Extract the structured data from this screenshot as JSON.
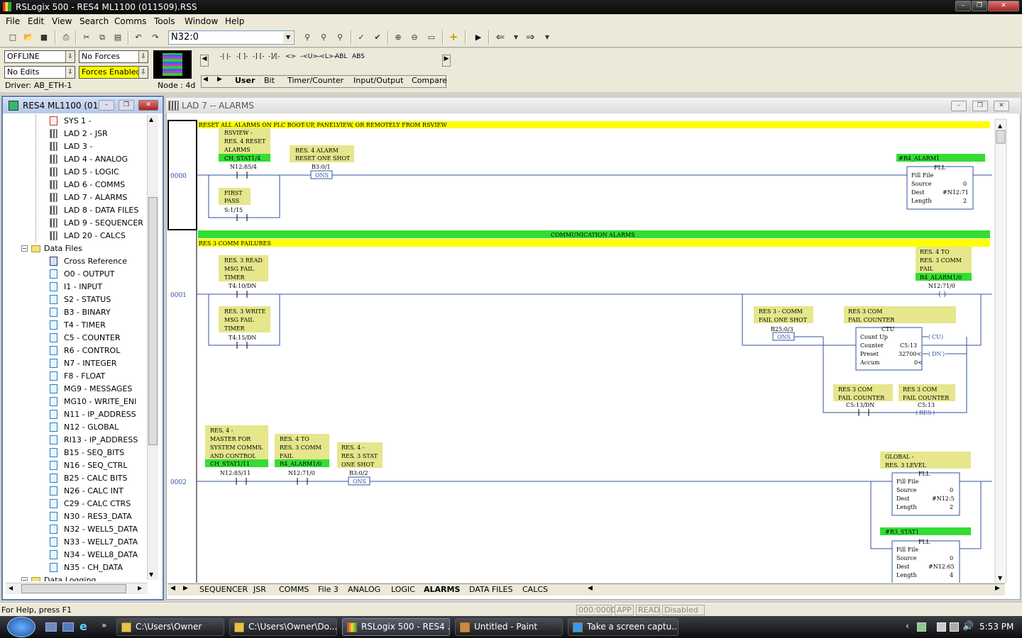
{
  "window": {
    "title": "RSLogix 500 - RES4 ML1100 (011509).RSS"
  },
  "menu": [
    "File",
    "Edit",
    "View",
    "Search",
    "Comms",
    "Tools",
    "Window",
    "Help"
  ],
  "address_box": "N32:0",
  "mode": {
    "online": "OFFLINE",
    "edits": "No Edits",
    "forces": "No Forces",
    "forces_enabled": "Forces Enabled",
    "driver": "Driver: AB_ETH-1",
    "node": "Node :  4d"
  },
  "instruction_palette": [
    "-| |-",
    "-[ ]-",
    "-] [-",
    "-]/[-",
    "<>",
    "-<U>-",
    "-<L>-",
    "ABL",
    "ABS"
  ],
  "instruction_tabs": [
    "User",
    "Bit",
    "Timer/Counter",
    "Input/Output",
    "Compare"
  ],
  "project_tree": {
    "title": "RES4 ML1100 (01...",
    "items": [
      {
        "label": "SYS 1 -",
        "type": "sys"
      },
      {
        "label": "LAD 2 - JSR",
        "type": "lad"
      },
      {
        "label": "LAD 3 -",
        "type": "lad"
      },
      {
        "label": "LAD 4 - ANALOG",
        "type": "lad"
      },
      {
        "label": "LAD 5 - LOGIC",
        "type": "lad"
      },
      {
        "label": "LAD 6 - COMMS",
        "type": "lad"
      },
      {
        "label": "LAD 7 - ALARMS",
        "type": "lad"
      },
      {
        "label": "LAD 8 - DATA FILES",
        "type": "lad"
      },
      {
        "label": "LAD 9 - SEQUENCER",
        "type": "lad"
      },
      {
        "label": "LAD 20 - CALCS",
        "type": "lad"
      },
      {
        "label": "Data Files",
        "type": "folder"
      },
      {
        "label": "Cross Reference",
        "type": "xref"
      },
      {
        "label": "O0 - OUTPUT",
        "type": "data"
      },
      {
        "label": "I1 - INPUT",
        "type": "data"
      },
      {
        "label": "S2 - STATUS",
        "type": "data"
      },
      {
        "label": "B3 - BINARY",
        "type": "data"
      },
      {
        "label": "T4 - TIMER",
        "type": "data"
      },
      {
        "label": "C5 - COUNTER",
        "type": "data"
      },
      {
        "label": "R6 - CONTROL",
        "type": "data"
      },
      {
        "label": "N7 - INTEGER",
        "type": "data"
      },
      {
        "label": "F8 - FLOAT",
        "type": "data"
      },
      {
        "label": "MG9 - MESSAGES",
        "type": "data"
      },
      {
        "label": "MG10 - WRITE_ENI",
        "type": "data"
      },
      {
        "label": "N11 - IP_ADDRESS",
        "type": "data"
      },
      {
        "label": "N12 - GLOBAL",
        "type": "data"
      },
      {
        "label": "RI13 - IP_ADDRESS",
        "type": "data"
      },
      {
        "label": "B15 - SEQ_BITS",
        "type": "data"
      },
      {
        "label": "N16 - SEQ_CTRL",
        "type": "data"
      },
      {
        "label": "B25 - CALC BITS",
        "type": "data"
      },
      {
        "label": "N26 - CALC INT",
        "type": "data"
      },
      {
        "label": "C29 - CALC CTRS",
        "type": "data"
      },
      {
        "label": "N30 - RES3_DATA",
        "type": "data"
      },
      {
        "label": "N32 - WELL5_DATA",
        "type": "data"
      },
      {
        "label": "N33 - WELL7_DATA",
        "type": "data"
      },
      {
        "label": "N34 - WELL8_DATA",
        "type": "data"
      },
      {
        "label": "N35 - CH_DATA",
        "type": "data"
      },
      {
        "label": "Data Logging",
        "type": "folder"
      }
    ]
  },
  "ladder": {
    "title": "LAD 7 -- ALARMS",
    "rung0": {
      "num": "0000",
      "comment": "RESET ALL ALARMS ON PLC BOOT-UP, PANELVIEW, OR REMOTELY FROM RSVIEW",
      "c1": [
        "RSVIEW -",
        "RES. 4 RESET",
        "ALARMS"
      ],
      "c1_sym": "CH_STAT1/4",
      "c1_addr": "N12:85/4",
      "ons": [
        "RES. 4 ALARM",
        "RESET ONE SHOT"
      ],
      "ons_addr": "B3:0/1",
      "ons_txt": "ONS",
      "fp": [
        "FIRST",
        "PASS"
      ],
      "fp_addr": "S:1/15",
      "fll_sym": "#R4_ALARM1",
      "fll_title": "FLL",
      "fll_name": "Fill File",
      "fll_src_l": "Source",
      "fll_src": "0",
      "fll_dest_l": "Dest",
      "fll_dest": "#N12:71",
      "fll_len_l": "Length",
      "fll_len": "2"
    },
    "rung1": {
      "num": "0001",
      "comment": "COMMUNICATION ALARMS",
      "comment2": "RES 3 COMM FAILURES",
      "c1": [
        "RES. 3 READ",
        "MSG FAIL",
        "TIMER"
      ],
      "c1_addr": "T4:10/DN",
      "c2": [
        "RES. 3 WRITE",
        "MSG FAIL",
        "TIMER"
      ],
      "c2_addr": "T4:15/DN",
      "ons": [
        "RES 3 - COMM",
        "FAIL ONE SHOT"
      ],
      "ons_addr": "B25:0/3",
      "ons_txt": "ONS",
      "ctu_desc": [
        "RES 3 COM",
        "FAIL COUNTER"
      ],
      "ctu_title": "CTU",
      "ctu_name": "Count Up",
      "ctu_c_l": "Counter",
      "ctu_c": "C5:13",
      "ctu_p_l": "Preset",
      "ctu_p": "32700<",
      "ctu_a_l": "Accum",
      "ctu_a": "0<",
      "cu": "CU",
      "dn": "DN",
      "c3": [
        "RES 3 COM",
        "FAIL COUNTER"
      ],
      "c3_addr": "C5:13/DN",
      "res": [
        "RES 3 COM",
        "FAIL COUNTER"
      ],
      "res_addr": "C5:13",
      "res_txt": "RES",
      "out": [
        "RES. 4 TO",
        "RES. 3 COMM",
        "FAIL"
      ],
      "out_sym": "R4_ALARM1/0",
      "out_addr": "N12:71/0"
    },
    "rung2": {
      "num": "0002",
      "c1": [
        "RES. 4 -",
        "MASTER FOR",
        "SYSTEM COMMS.",
        "AND CONTROL"
      ],
      "c1_sym": "CH_STAT1/11",
      "c1_addr": "N12:85/11",
      "c2": [
        "RES. 4 TO",
        "RES. 3 COMM",
        "FAIL"
      ],
      "c2_sym": "R4_ALARM1/0",
      "c2_addr": "N12:71/0",
      "ons": [
        "RES. 4 -",
        "RES. 3 STAT",
        "ONE SHOT"
      ],
      "ons_addr": "B3:0/2",
      "ons_txt": "ONS",
      "fll1_desc": [
        "GLOBAL -",
        "RES. 3 LEVEL"
      ],
      "fll1_title": "FLL",
      "fll1_name": "Fill File",
      "fll1_src_l": "Source",
      "fll1_src": "0",
      "fll1_dest_l": "Dest",
      "fll1_dest": "#N12:5",
      "fll1_len_l": "Length",
      "fll1_len": "2",
      "fll2_sym": "#R3_STAT1",
      "fll2_title": "FLL",
      "fll2_name": "Fill File",
      "fll2_src_l": "Source",
      "fll2_src": "0",
      "fll2_dest_l": "Dest",
      "fll2_dest": "#N12:65",
      "fll2_len_l": "Length",
      "fll2_len": "4"
    }
  },
  "bottom_tabs": [
    "SEQUENCER",
    "JSR",
    "COMMS",
    "File 3",
    "ANALOG",
    "LOGIC",
    "ALARMS",
    "DATA FILES",
    "CALCS"
  ],
  "status": {
    "help": "For Help, press F1",
    "addr": "000:0000",
    "app": "APP",
    "read": "READ",
    "disabled": "Disabled"
  },
  "taskbar": {
    "items": [
      "C:\\Users\\Owner",
      "C:\\Users\\Owner\\Do...",
      "RSLogix 500 - RES4 ...",
      "Untitled - Paint",
      "Take a screen captu..."
    ],
    "time": "5:53 PM"
  },
  "colors": {
    "comment_yellow": "#ffff00",
    "symbol_green": "#33dd33",
    "desc_tan": "#e6e68c",
    "rung_blue": "#3050a0"
  }
}
